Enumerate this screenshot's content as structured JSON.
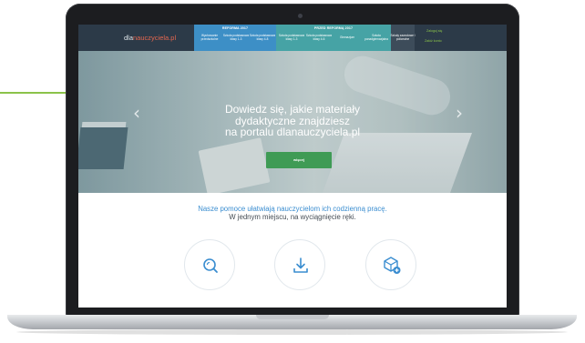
{
  "logo": {
    "part1": "dla",
    "part2": "nauczyciela.pl"
  },
  "nav": {
    "reforma2017": {
      "header": "REFORMA 2017",
      "items": [
        "Wychowanie przedszkolne",
        "Szkoła podstawowa klasy 1-3",
        "Szkoła podstawowa klasy 4-8"
      ]
    },
    "przed_reforma": {
      "header": "PRZED REFORMĄ 2017",
      "items": [
        "Szkoła podstawowa klasy 1-3",
        "Szkoła podstawowa klasy 4-6",
        "Gimnazjum",
        "Szkoła ponadgimnazjalna"
      ]
    },
    "szkolnictwo": "Szkoły zawodowe i policealne",
    "zaloguj": "Zaloguj się",
    "zaloz_konto": "Załóż konto"
  },
  "hero": {
    "title_lines": [
      "Dowiedz się, jakie materiały",
      "dydaktyczne znajdziesz",
      "na portalu dlanauczyciela.pl"
    ],
    "button": "więcej"
  },
  "tagline": {
    "line1": "Nasze pomoce ułatwiają nauczycielom ich codzienną pracę.",
    "line2": "W jednym miejscu, na wyciągnięcie ręki."
  },
  "features": [
    {
      "icon": "search-icon"
    },
    {
      "icon": "download-icon"
    },
    {
      "icon": "box-plus-icon"
    }
  ],
  "colors": {
    "nav_bg": "#2c3a48",
    "reforma_blue": "#3d8fc6",
    "przed_teal": "#46a3a5",
    "accent_green": "#8bc34a",
    "button_green": "#3f9b55",
    "link_blue": "#3a8dd0"
  }
}
